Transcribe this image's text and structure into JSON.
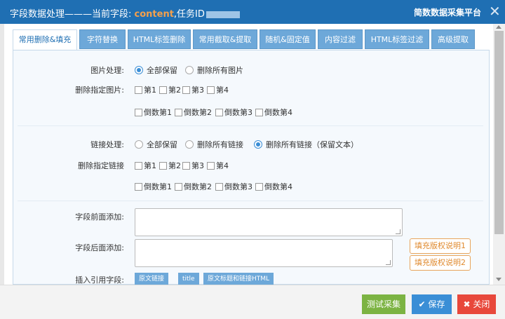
{
  "titlebar": {
    "title_prefix": "字段数据处理———当前字段: ",
    "field_name": "content",
    "task_label": ",任务ID",
    "brand": "简数数据采集平台",
    "close_glyph": "✕"
  },
  "tabs": [
    {
      "label": "常用删除&填充",
      "active": true
    },
    {
      "label": "字符替换"
    },
    {
      "label": "HTML标签删除"
    },
    {
      "label": "常用截取&提取"
    },
    {
      "label": "随机&固定值"
    },
    {
      "label": "内容过滤"
    },
    {
      "label": "HTML标签过滤"
    },
    {
      "label": "高级提取"
    }
  ],
  "image_section": {
    "label": "图片处理:",
    "options": [
      {
        "label": "全部保留",
        "selected": true
      },
      {
        "label": "删除所有图片",
        "selected": false
      }
    ],
    "delete_label": "删除指定图片:",
    "checks_row1": [
      "第1",
      "第2",
      "第3",
      "第4"
    ],
    "checks_row2": [
      "倒数第1",
      "倒数第2",
      "倒数第3",
      "倒数第4"
    ]
  },
  "link_section": {
    "label": "链接处理:",
    "options": [
      {
        "label": "全部保留",
        "selected": false
      },
      {
        "label": "删除所有链接",
        "selected": false
      },
      {
        "label": "删除所有链接（保留文本）",
        "selected": true
      }
    ],
    "delete_label": "删除指定链接",
    "checks_row1": [
      "第1",
      "第2",
      "第3",
      "第4"
    ],
    "checks_row2": [
      "倒数第1",
      "倒数第2",
      "倒数第3",
      "倒数第4"
    ]
  },
  "prefix": {
    "label": "字段前面添加:",
    "value": ""
  },
  "suffix": {
    "label": "字段后面添加:",
    "value": ""
  },
  "copyright_buttons": [
    "填充版权说明1",
    "填充版权说明2"
  ],
  "insert": {
    "label": "插入引用字段:",
    "buttons": [
      "原文链接",
      "title",
      "原文标题和链接HTML"
    ]
  },
  "footer": {
    "test": "测试采集",
    "save": "保存",
    "close": "关闭",
    "colors": {
      "test": "#7cb342",
      "save": "#3a8ed6",
      "close": "#e8483b"
    }
  }
}
